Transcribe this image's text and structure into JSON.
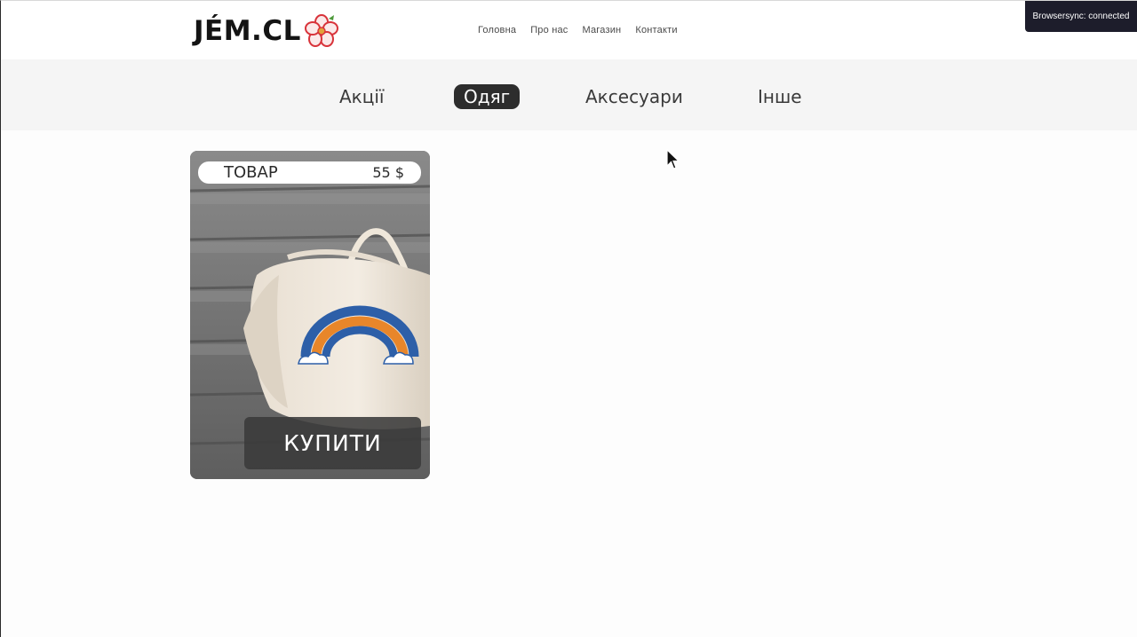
{
  "header": {
    "logo_text": "JÉM.CL",
    "logo_icon": "hibiscus-flower-icon",
    "nav": [
      {
        "label": "Головна"
      },
      {
        "label": "Про нас"
      },
      {
        "label": "Магазин"
      },
      {
        "label": "Контакти"
      }
    ]
  },
  "browsersync": {
    "text": "Browsersync: connected"
  },
  "categories": {
    "items": [
      {
        "label": "Акції"
      },
      {
        "label": "Одяг",
        "active": true
      },
      {
        "label": "Аксесуари"
      },
      {
        "label": "Інше"
      }
    ]
  },
  "products": [
    {
      "name": "ТОВАР",
      "price": "55 $",
      "buy_label": "КУПИТИ",
      "image_subject": "tote bag with rainbow print"
    }
  ],
  "colors": {
    "active_category_bg": "#2d2d2d",
    "category_bar_bg": "#f5f5f5",
    "badge_bg": "#1d1d2b",
    "logo_flower": "#d8333a"
  }
}
